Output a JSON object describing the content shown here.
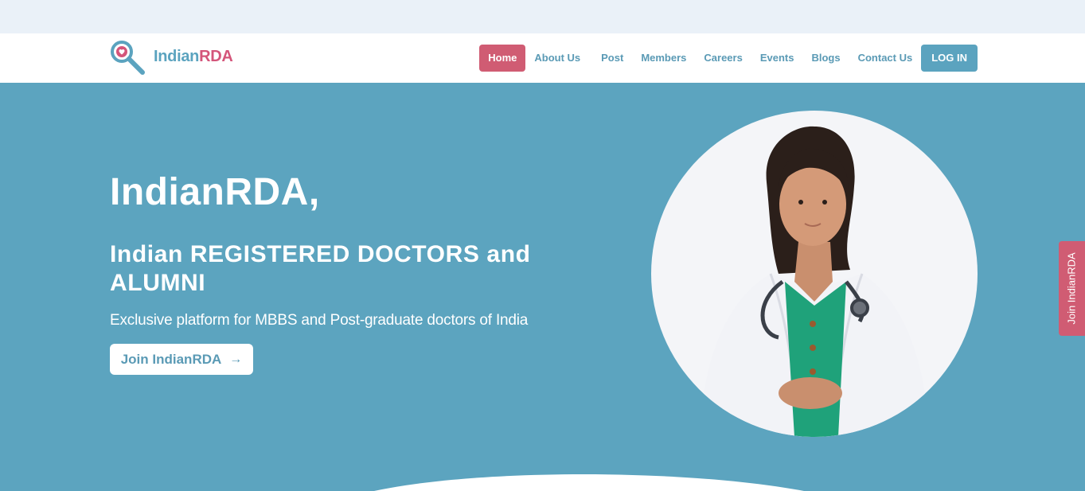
{
  "brand": {
    "part1": "Indian",
    "part2": "RDA",
    "accent": "#d4557a",
    "primary": "#5ba3bf",
    "icon": "magnifier-logo-icon"
  },
  "nav": {
    "items": [
      {
        "label": "Home",
        "active": true
      },
      {
        "label": "About Us"
      },
      {
        "label": "Post"
      },
      {
        "label": "Members"
      },
      {
        "label": "Careers"
      },
      {
        "label": "Events"
      },
      {
        "label": "Blogs"
      },
      {
        "label": "Contact Us"
      }
    ],
    "login_label": "LOG IN"
  },
  "hero": {
    "title": "IndianRDA,",
    "subtitle": "Indian REGISTERED DOCTORS and ALUMNI",
    "description": "Exclusive platform for MBBS and Post-graduate doctors of India",
    "cta_label": "Join IndianRDA",
    "cta_icon": "arrow-right-icon",
    "background": "#5ca4bf"
  },
  "side_tab": {
    "label": "Join IndianRDA",
    "color": "#d05c73"
  }
}
